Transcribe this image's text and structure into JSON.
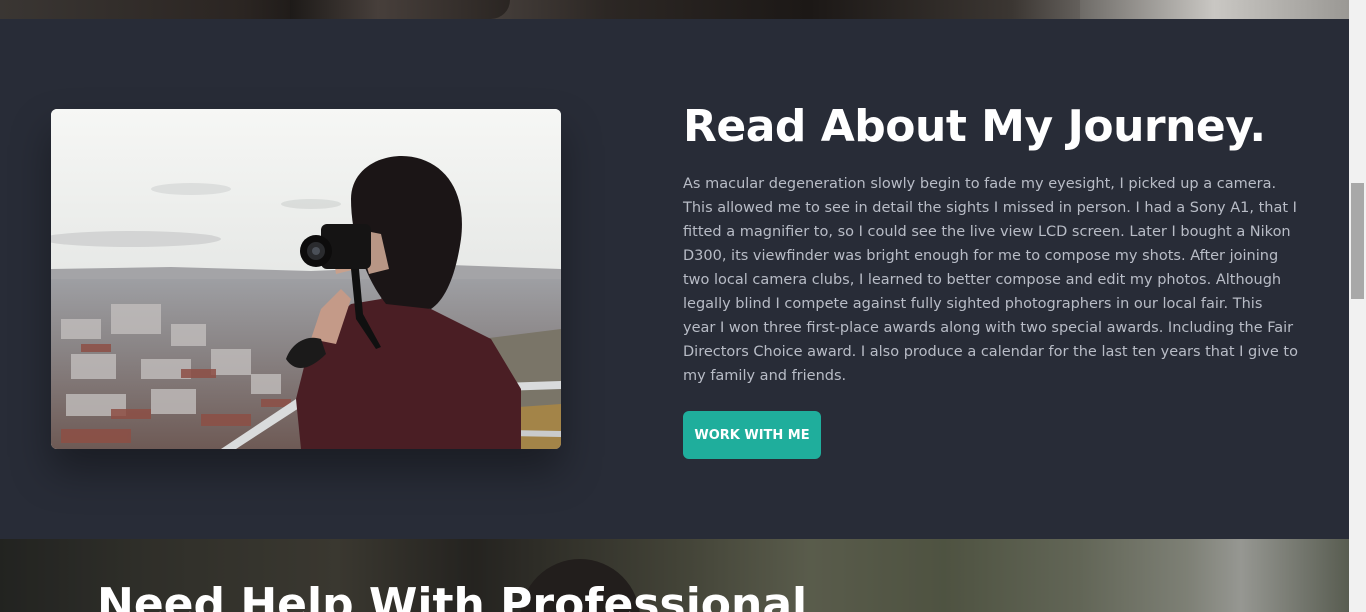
{
  "about": {
    "title": "Read About My Journey.",
    "body": "As macular degeneration slowly begin to fade my eyesight, I picked up a camera. This allowed me to see in detail the sights I missed in person. I had a Sony A1, that I fitted a magnifier to, so I could see the live view LCD screen. Later I bought a Nikon D300, its viewfinder was bright enough for me to compose my shots. After joining two local camera clubs, I learned to better compose and edit my photos. Although legally blind I compete against fully sighted photographers in our local fair. This year I won three first-place awards along with two special awards. Including the Fair Directors Choice award. I also produce a calendar for the last ten years that I give to my family and friends.",
    "cta_label": "WORK WITH ME"
  },
  "next_section": {
    "title": "Need Help With Professional"
  },
  "colors": {
    "background": "#282c37",
    "accent": "#1fae9c",
    "title": "#ffffff",
    "body_text": "#b8bcc6"
  }
}
